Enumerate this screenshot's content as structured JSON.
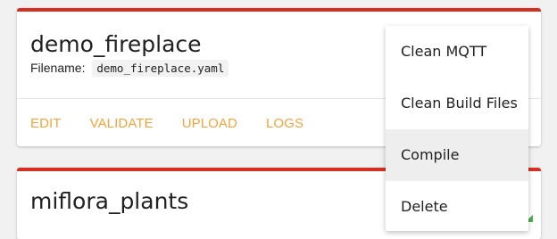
{
  "cards": [
    {
      "title": "demo_fireplace",
      "filename_label": "Filename:",
      "filename": "demo_fireplace.yaml",
      "actions": [
        "EDIT",
        "VALIDATE",
        "UPLOAD",
        "LOGS"
      ]
    },
    {
      "title": "miflora_plants"
    }
  ],
  "menu": {
    "items": [
      "Clean MQTT",
      "Clean Build Files",
      "Compile",
      "Delete"
    ],
    "highlighted_item": "Compile"
  },
  "colors": {
    "accent_bar": "#d32f22",
    "action_text": "#f5a33a",
    "status_edge": "#4caf50"
  }
}
